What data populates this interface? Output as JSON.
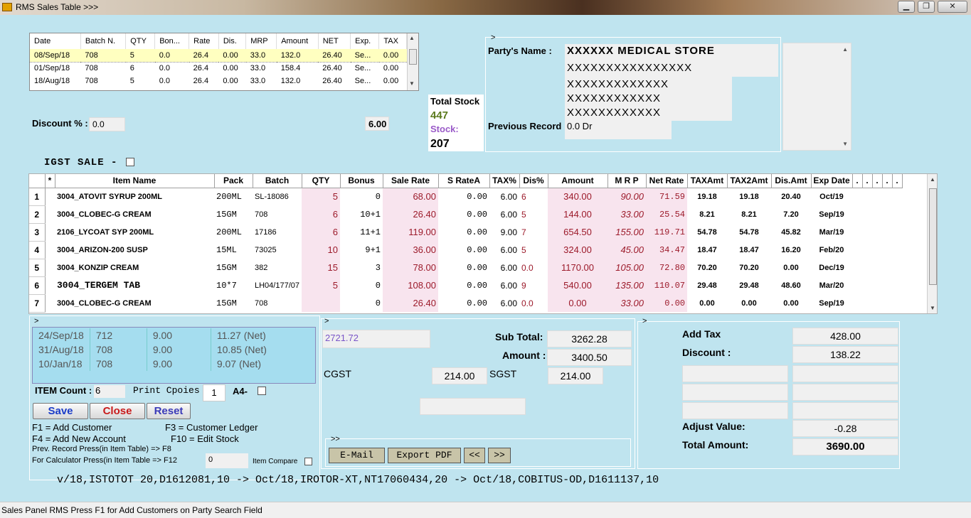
{
  "window": {
    "title": "RMS Sales Table >>>",
    "min_label": "▁",
    "max_label": "❐",
    "close_label": "✕"
  },
  "history_mini": {
    "headers": [
      "Date",
      "Batch N.",
      "QTY",
      "Bon...",
      "Rate",
      "Dis.",
      "MRP",
      "Amount",
      "NET",
      "Exp.",
      "TAX"
    ],
    "rows": [
      [
        "08/Sep/18",
        "708",
        "5",
        "0.0",
        "26.4",
        "0.00",
        "33.0",
        "132.0",
        "26.40",
        "Se...",
        "0.00"
      ],
      [
        "01/Sep/18",
        "708",
        "6",
        "0.0",
        "26.4",
        "0.00",
        "33.0",
        "158.4",
        "26.40",
        "Se...",
        "0.00"
      ],
      [
        "18/Aug/18",
        "708",
        "5",
        "0.0",
        "26.4",
        "0.00",
        "33.0",
        "132.0",
        "26.40",
        "Se...",
        "0.00"
      ]
    ]
  },
  "discount": {
    "label": "Discount % :",
    "value": "0.0",
    "side_value": "6.00"
  },
  "igst": {
    "label": "IGST SALE -"
  },
  "stock": {
    "total_label": "Total Stock",
    "total_value": "447",
    "stock_label": "Stock:",
    "stock_value": "207"
  },
  "party": {
    "marker": ">",
    "name_label": "Party's Name :",
    "name_value": "XXXXXX MEDICAL STORE",
    "line2": "XXXXXXXXXXXXXXXX",
    "line3": "XXXXXXXXXXXXX",
    "line4": "XXXXXXXXXXXX",
    "line5": "XXXXXXXXXXXX",
    "prev_label": "Previous Record",
    "prev_value": "0.0 Dr"
  },
  "grid": {
    "headers": [
      "*",
      "Item Name",
      "Pack",
      "Batch",
      "QTY",
      "Bonus",
      "Sale Rate",
      "S RateA",
      "TAX%",
      "Dis%",
      "Amount",
      "M R P",
      "Net Rate",
      "TAXAmt",
      "TAX2Amt",
      "Dis.Amt",
      "Exp Date",
      ".",
      ".",
      ".",
      ".",
      "."
    ],
    "rows": [
      {
        "n": "1",
        "item": "3004_ATOVIT SYRUP 200ML",
        "pack": "200ML",
        "batch": "SL-18086",
        "qty": "5",
        "bonus": "0",
        "rate": "68.00",
        "ratea": "0.00",
        "tax": "6.00",
        "dis": "6",
        "amount": "340.00",
        "mrp": "90.00",
        "net": "71.59",
        "taxamt": "19.18",
        "tax2amt": "19.18",
        "disamt": "20.40",
        "exp": "Oct/19"
      },
      {
        "n": "2",
        "item": "3004_CLOBEC-G CREAM",
        "pack": "15GM",
        "batch": "708",
        "qty": "6",
        "bonus": "10+1",
        "rate": "26.40",
        "ratea": "0.00",
        "tax": "6.00",
        "dis": "5",
        "amount": "144.00",
        "mrp": "33.00",
        "net": "25.54",
        "taxamt": "8.21",
        "tax2amt": "8.21",
        "disamt": "7.20",
        "exp": "Sep/19"
      },
      {
        "n": "3",
        "item": "2106_LYCOAT SYP 200ML",
        "pack": "200ML",
        "batch": "17186",
        "qty": "6",
        "bonus": "11+1",
        "rate": "119.00",
        "ratea": "0.00",
        "tax": "9.00",
        "dis": "7",
        "amount": "654.50",
        "mrp": "155.00",
        "net": "119.71",
        "taxamt": "54.78",
        "tax2amt": "54.78",
        "disamt": "45.82",
        "exp": "Mar/19"
      },
      {
        "n": "4",
        "item": "3004_ARIZON-200 SUSP",
        "pack": "15ML",
        "batch": "73025",
        "qty": "10",
        "bonus": "9+1",
        "rate": "36.00",
        "ratea": "0.00",
        "tax": "6.00",
        "dis": "5",
        "amount": "324.00",
        "mrp": "45.00",
        "net": "34.47",
        "taxamt": "18.47",
        "tax2amt": "18.47",
        "disamt": "16.20",
        "exp": "Feb/20"
      },
      {
        "n": "5",
        "item": "3004_KONZIP CREAM",
        "pack": "15GM",
        "batch": "382",
        "qty": "15",
        "bonus": "3",
        "rate": "78.00",
        "ratea": "0.00",
        "tax": "6.00",
        "dis": "0.0",
        "amount": "1170.00",
        "mrp": "105.00",
        "net": "72.80",
        "taxamt": "70.20",
        "tax2amt": "70.20",
        "disamt": "0.00",
        "exp": "Dec/19"
      },
      {
        "n": "6",
        "item": "3004_TERGEM TAB",
        "pack": "10*7",
        "batch": "LH04/177/07",
        "qty": "5",
        "bonus": "0",
        "rate": "108.00",
        "ratea": "0.00",
        "tax": "6.00",
        "dis": "9",
        "amount": "540.00",
        "mrp": "135.00",
        "net": "110.07",
        "taxamt": "29.48",
        "tax2amt": "29.48",
        "disamt": "48.60",
        "exp": "Mar/20"
      },
      {
        "n": "7",
        "item": "3004_CLOBEC-G CREAM",
        "pack": "15GM",
        "batch": "708",
        "qty": "",
        "bonus": "0",
        "rate": "26.40",
        "ratea": "0.00",
        "tax": "6.00",
        "dis": "0.0",
        "amount": "0.00",
        "mrp": "33.00",
        "net": "0.00",
        "taxamt": "0.00",
        "tax2amt": "0.00",
        "disamt": "0.00",
        "exp": "Sep/19"
      }
    ]
  },
  "purchase_history": [
    [
      "24/Sep/18",
      "712",
      "9.00",
      "11.27 (Net)"
    ],
    [
      "31/Aug/18",
      "708",
      "9.00",
      "10.85 (Net)"
    ],
    [
      "10/Jan/18",
      "708",
      "9.00",
      "9.07 (Net)"
    ]
  ],
  "counts": {
    "item_label": "ITEM Count :",
    "item_value": "6",
    "print_label": "Print Cpoies",
    "print_value": "1",
    "a4_label": "A4-"
  },
  "buttons": {
    "save": "Save",
    "close": "Close",
    "reset": "Reset",
    "email": "E-Mail",
    "export": "Export PDF",
    "prev": "<<",
    "next": ">>"
  },
  "shortcuts": {
    "f1": "F1 = Add Customer",
    "f3": "F3 = Customer Ledger",
    "f4": "F4 = Add New Account",
    "f10": "F10 = Edit Stock",
    "prev": "Prev. Record Press(in Item Table)  => F8",
    "calc": "For Calculator Press(in Item Table  => F12",
    "calc_value": "0",
    "compare": "Item Compare"
  },
  "middle": {
    "marker": ">",
    "left_value": "2721.72",
    "subtotal_label": "Sub Total:",
    "subtotal_value": "3262.28",
    "amount_label": "Amount :",
    "amount_value": "3400.50",
    "cgst_label": "CGST",
    "cgst_value": "214.00",
    "sgst_label": "SGST",
    "sgst_value": "214.00",
    "nav_marker": ">>"
  },
  "right": {
    "marker": ">",
    "addtax_label": "Add Tax",
    "addtax_value": "428.00",
    "discount_label": "Discount :",
    "discount_value": "138.22",
    "adjust_label": "Adjust Value:",
    "adjust_value": "-0.28",
    "total_label": "Total Amount:",
    "total_value": "3690.00"
  },
  "ticker": "v/18,ISTOTOT 20,D1612081,10 -> Oct/18,IROTOR-XT,NT17060434,20 -> Oct/18,COBITUS-OD,D1611137,10",
  "status": "Sales Panel RMS Press F1 for Add Customers on Party Search Field",
  "colors": {
    "background": "#bfe4ef",
    "qty_red": "#9c1a2a",
    "pink": "#f8e4ee",
    "history_blue": "#a5ddef",
    "save_blue": "#1a3cc8",
    "close_red": "#c81a1a"
  }
}
